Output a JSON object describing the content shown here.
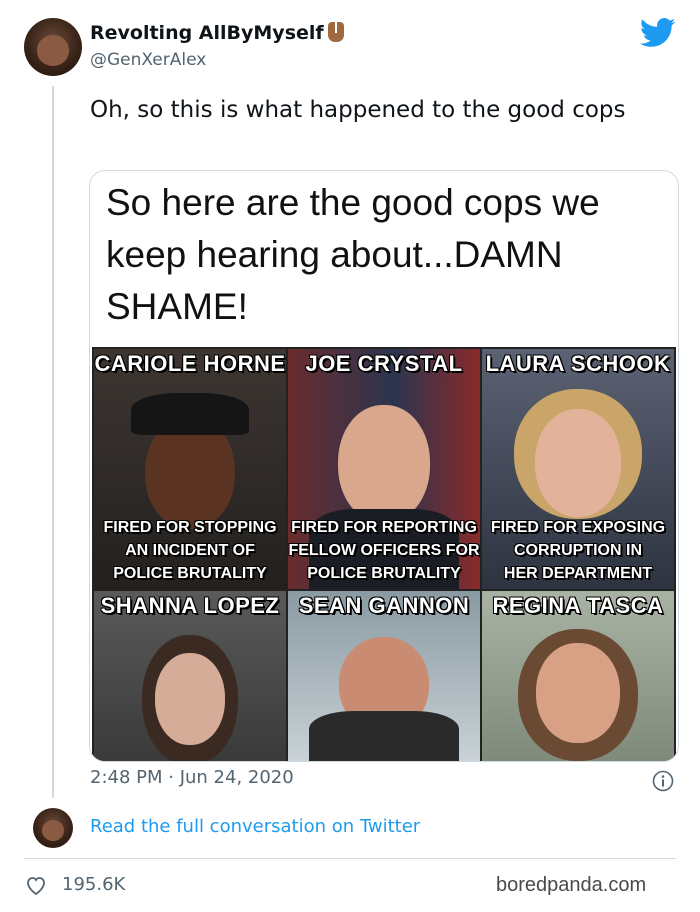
{
  "author": {
    "display_name": "Revolting AllByMyself",
    "handle": "@GenXerAlex"
  },
  "tweet": {
    "text": "Oh, so this is what happened to the good cops",
    "timestamp": "2:48 PM · Jun 24, 2020",
    "likes": "195.6K"
  },
  "image": {
    "caption": "So here are the good cops we keep hearing about...DAMN SHAME!",
    "panels": [
      {
        "name": "CARIOLE HORNE",
        "description": "FIRED FOR STOPPING\nAN INCIDENT OF\nPOLICE BRUTALITY"
      },
      {
        "name": "JOE CRYSTAL",
        "description": "FIRED FOR REPORTING\nFELLOW OFFICERS FOR\nPOLICE BRUTALITY"
      },
      {
        "name": "LAURA SCHOOK",
        "description": "FIRED FOR EXPOSING\nCORRUPTION IN\nHER DEPARTMENT"
      },
      {
        "name": "SHANNA LOPEZ",
        "description": ""
      },
      {
        "name": "SEAN GANNON",
        "description": ""
      },
      {
        "name": "REGINA TASCA",
        "description": ""
      }
    ]
  },
  "footer": {
    "read_link": "Read the full conversation on Twitter",
    "watermark": "boredpanda.com"
  },
  "icons": {
    "twitter_logo": "twitter-bird-icon",
    "info": "info-icon",
    "like": "heart-icon",
    "emoji": "vulcan-salute-icon"
  },
  "colors": {
    "accent": "#1d9bf0",
    "muted": "#536471",
    "border": "#cfd9de"
  }
}
